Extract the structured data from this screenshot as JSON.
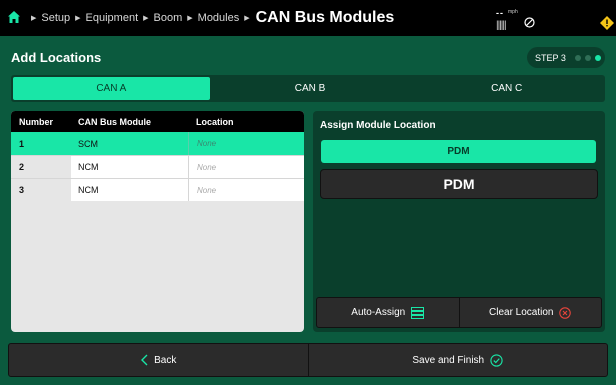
{
  "breadcrumb": {
    "items": [
      "Setup",
      "Equipment",
      "Boom",
      "Modules"
    ],
    "current": "CAN Bus Modules"
  },
  "status": {
    "speed": "--",
    "speed_unit": "mph",
    "signal_bars": "||||||"
  },
  "header": {
    "title": "Add Locations",
    "step": "STEP 3"
  },
  "tabs": [
    {
      "label": "CAN A",
      "active": true
    },
    {
      "label": "CAN B",
      "active": false
    },
    {
      "label": "CAN C",
      "active": false
    }
  ],
  "table": {
    "headers": [
      "Number",
      "CAN Bus Module",
      "Location"
    ],
    "rows": [
      {
        "number": "1",
        "module": "SCM",
        "location": "None"
      },
      {
        "number": "2",
        "module": "NCM",
        "location": "None"
      },
      {
        "number": "3",
        "module": "NCM",
        "location": "None"
      }
    ]
  },
  "assign": {
    "label": "Assign Module Location",
    "option": "PDM",
    "selected_value": "PDM",
    "auto_assign": "Auto-Assign",
    "clear_location": "Clear Location"
  },
  "footer": {
    "back": "Back",
    "save": "Save and Finish"
  },
  "colors": {
    "accent": "#19e6a7",
    "background": "#0b5a3e",
    "panel": "#0a3f2c",
    "warning": "#f5c518",
    "danger": "#e8453c"
  }
}
